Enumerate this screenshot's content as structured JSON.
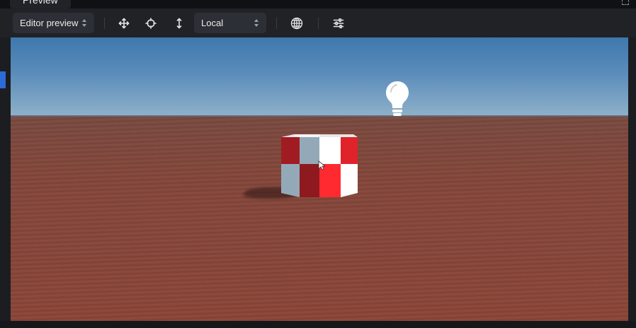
{
  "panel": {
    "tab_label": "Preview"
  },
  "toolbar": {
    "view_mode": "Editor preview",
    "space": "Local",
    "icons": [
      "move-icon",
      "rotate-target-icon",
      "scale-vertical-icon",
      "globe-icon",
      "sliders-icon"
    ]
  },
  "scene": {
    "sky_color": "#4a80b2",
    "ground_color": "#84473b",
    "cube_colors": [
      "#c81e23",
      "#ffffff",
      "#94a9b8"
    ]
  }
}
